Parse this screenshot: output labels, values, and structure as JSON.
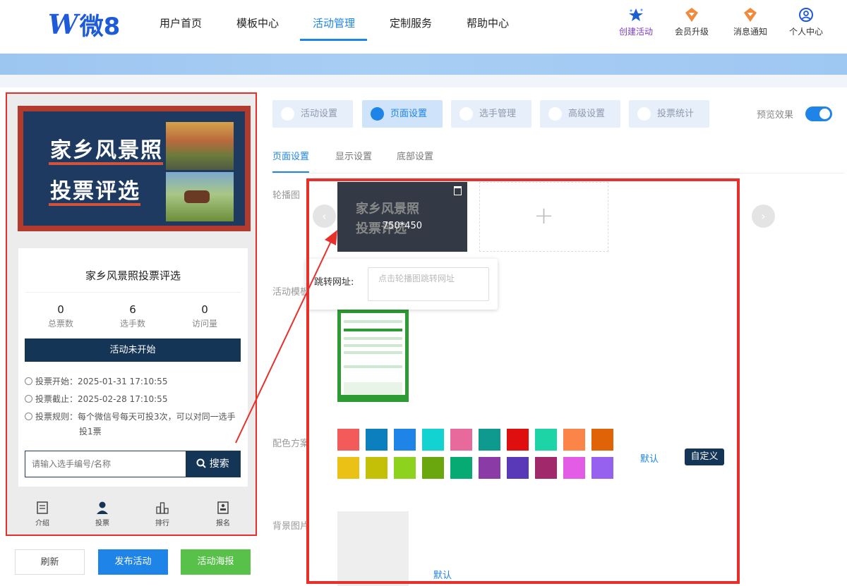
{
  "logo": {
    "mark": "W",
    "text": "微8"
  },
  "nav": {
    "items": [
      "用户首页",
      "模板中心",
      "活动管理",
      "定制服务",
      "帮助中心"
    ],
    "active": "活动管理"
  },
  "tools": [
    "创建活动",
    "会员升级",
    "消息通知",
    "个人中心"
  ],
  "phone": {
    "poster": {
      "line1": "家乡风景照",
      "line2": "投票评选"
    },
    "title": "家乡风景照投票评选",
    "stats": [
      {
        "value": "0",
        "label": "总票数"
      },
      {
        "value": "6",
        "label": "选手数"
      },
      {
        "value": "0",
        "label": "访问量"
      }
    ],
    "status": "活动未开始",
    "start": "投票开始：2025-01-31 17:10:55",
    "end": "投票截止：2025-02-28 17:10:55",
    "rule_line1": "投票规则：每个微信号每天可投3次，可以对同一选手",
    "rule_line2": "投1票",
    "search_placeholder": "请输入选手编号/名称",
    "search_btn": "搜索",
    "tabs": [
      "介绍",
      "投票",
      "排行",
      "报名"
    ]
  },
  "actions": {
    "refresh": "刷新",
    "publish": "发布活动",
    "poster": "活动海报"
  },
  "settings": {
    "tabs": [
      "活动设置",
      "页面设置",
      "选手管理",
      "高级设置",
      "投票统计"
    ],
    "active_tab": "页面设置",
    "preview_label": "预览效果",
    "subtabs": [
      "页面设置",
      "显示设置",
      "底部设置"
    ],
    "labels": {
      "carousel": "轮播图",
      "template": "活动模板",
      "color": "配色方案",
      "background": "背景图片"
    },
    "carousel_size": "750*450",
    "add_symbol": "+",
    "link_label": "跳转网址:",
    "link_placeholder": "点击轮播图跳转网址",
    "default_label": "默认",
    "custom_label": "自定义",
    "bg_default": "默认"
  },
  "colors": {
    "row1": [
      "#f35a5a",
      "#0c7fbf",
      "#1e84e8",
      "#13d2d2",
      "#e8699b",
      "#0e9a8e",
      "#e00f0f",
      "#1dd4a6",
      "#fb8448",
      "#e06308"
    ],
    "row2": [
      "#ebc116",
      "#c4c007",
      "#8dd21d",
      "#6aa60d",
      "#08aa73",
      "#8b3ba5",
      "#5a39b8",
      "#a1296b",
      "#e25ce6",
      "#9661ee"
    ],
    "accent": "#1e84e8",
    "dark": "#143556",
    "highlight": "#e8302a"
  }
}
